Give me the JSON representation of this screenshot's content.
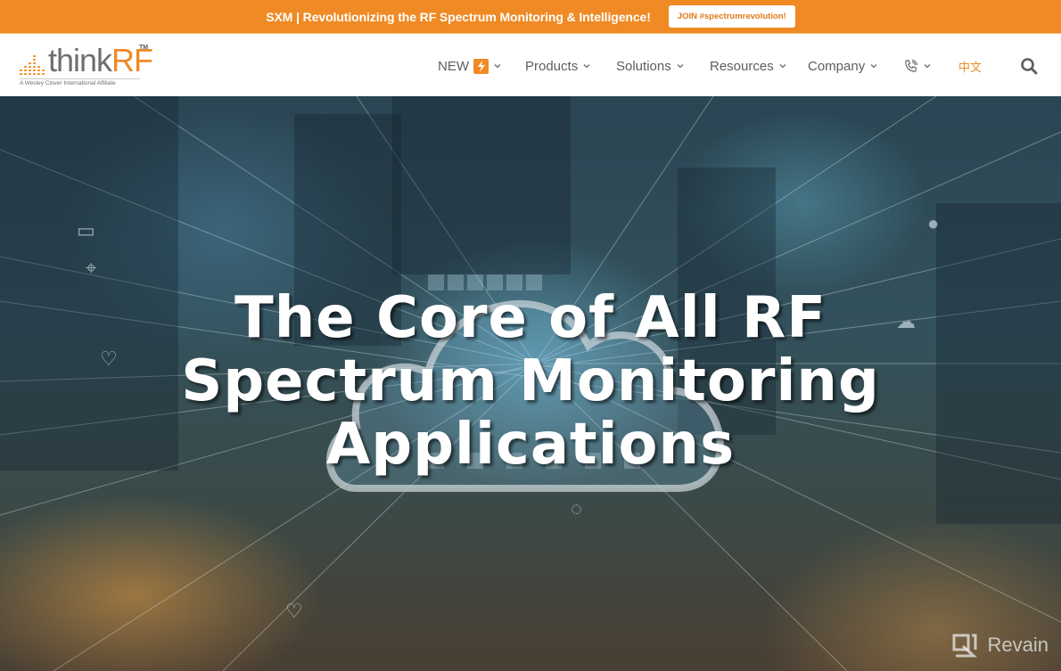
{
  "announcement": {
    "text": "SXM | Revolutionizing the RF Spectrum Monitoring & Intelligence!",
    "button_label": "JOIN #spectrumrevolution!"
  },
  "brand": {
    "name_part1": "think",
    "name_part2": "RF",
    "trademark": "TM",
    "tagline": "A Wesley Clover International Affiliate",
    "accent_color": "#ef8a24",
    "gray_color": "#6d6e70"
  },
  "nav": {
    "items": [
      {
        "label": "NEW",
        "icon": "lightning-bolt-icon",
        "has_dropdown": true
      },
      {
        "label": "Products",
        "has_dropdown": true
      },
      {
        "label": "Solutions",
        "has_dropdown": true
      },
      {
        "label": "Resources",
        "has_dropdown": true
      },
      {
        "label": "Company",
        "has_dropdown": true
      },
      {
        "label": "",
        "icon": "phone-icon",
        "has_dropdown": true
      }
    ],
    "language_label": "中文",
    "search_icon": "search-icon"
  },
  "hero": {
    "title_line1": "The Core of All RF",
    "title_line2": "Spectrum Monitoring",
    "title_line3": "Applications",
    "background": "city-night-aerial-with-cloud-network-graphic"
  },
  "watermark": {
    "label": "Revain",
    "icon": "revain-logo-icon"
  }
}
